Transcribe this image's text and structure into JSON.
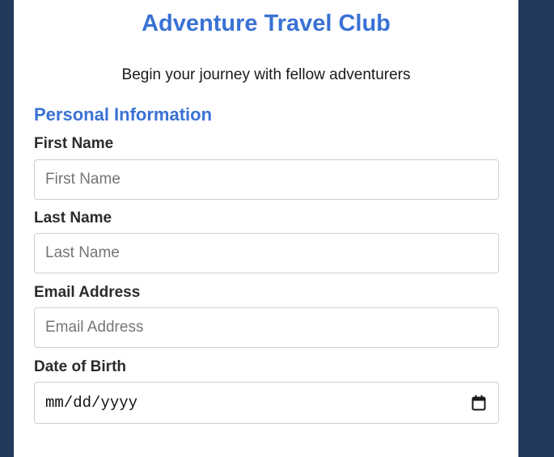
{
  "header": {
    "title": "Adventure Travel Club",
    "subtitle": "Begin your journey with fellow adventurers"
  },
  "section": {
    "heading": "Personal Information"
  },
  "fields": {
    "first_name": {
      "label": "First Name",
      "placeholder": "First Name",
      "value": ""
    },
    "last_name": {
      "label": "Last Name",
      "placeholder": "Last Name",
      "value": ""
    },
    "email": {
      "label": "Email Address",
      "placeholder": "Email Address",
      "value": ""
    },
    "dob": {
      "label": "Date of Birth",
      "format_text": "mm/dd/yyyy",
      "icon": "calendar-icon"
    }
  },
  "colors": {
    "background": "#22385c",
    "accent": "#3a72d4",
    "card": "#ffffff"
  }
}
